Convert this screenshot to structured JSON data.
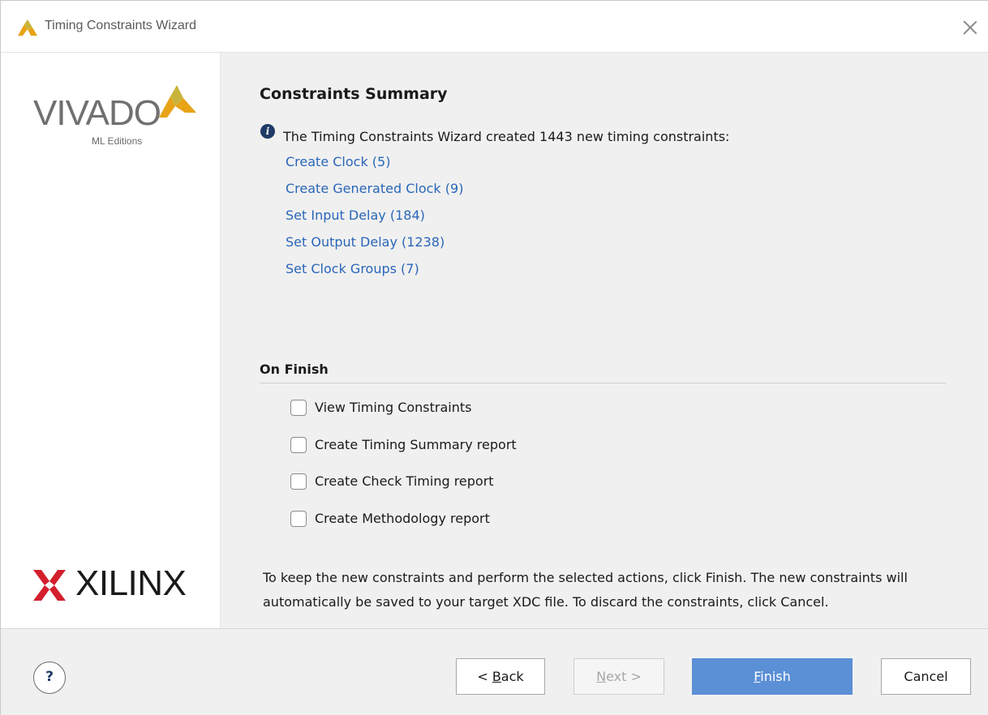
{
  "window": {
    "title": "Timing Constraints Wizard"
  },
  "brand": {
    "vivado_text": "VIVADO",
    "edition_text": "ML Editions",
    "xilinx_text": "XILINX"
  },
  "summary": {
    "title": "Constraints Summary",
    "info": "The Timing Constraints Wizard created 1443 new timing constraints:",
    "links": [
      {
        "label": "Create Clock (5)"
      },
      {
        "label": "Create Generated Clock (9)"
      },
      {
        "label": "Set Input Delay (184)"
      },
      {
        "label": "Set Output Delay (1238)"
      },
      {
        "label": "Set Clock Groups (7)"
      }
    ]
  },
  "on_finish": {
    "title": "On Finish",
    "options": [
      {
        "label": "View Timing Constraints",
        "checked": false
      },
      {
        "label": "Create Timing Summary report",
        "checked": false
      },
      {
        "label": "Create Check Timing report",
        "checked": false
      },
      {
        "label": "Create Methodology report",
        "checked": false
      }
    ]
  },
  "footer": {
    "text": "To keep the new constraints and perform the selected actions, click Finish. The new constraints will automatically be saved to your target XDC file. To discard the constraints, click Cancel."
  },
  "buttons": {
    "help": "?",
    "back_prefix": "< ",
    "back_underline": "B",
    "back_rest": "ack",
    "next_underline": "N",
    "next_rest": "ext >",
    "finish_underline": "F",
    "finish_rest": "inish",
    "cancel": "Cancel"
  },
  "colors": {
    "link": "#2a66b8",
    "primary_button": "#5b8fd6",
    "vivado_mark": "#c8b43a",
    "xilinx_red": "#d31f2d"
  }
}
